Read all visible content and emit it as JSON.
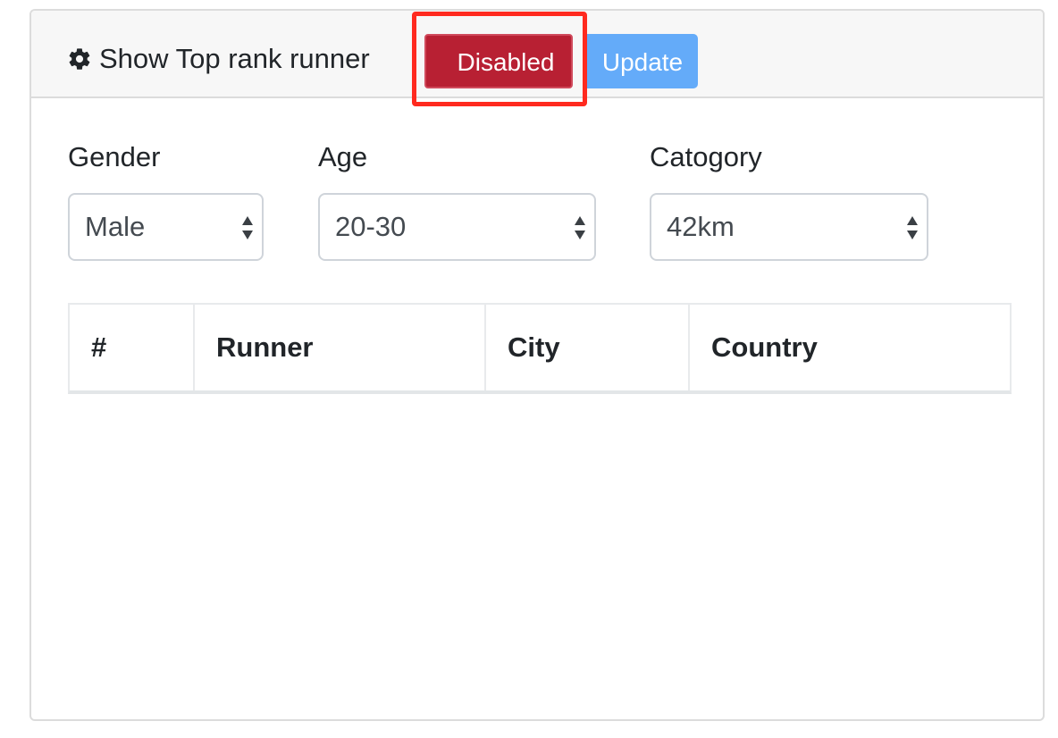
{
  "header": {
    "icon": "gear-icon",
    "title": "Show Top rank runner",
    "disabled_label": "Disabled",
    "update_label": "Update",
    "colors": {
      "disabled_bg": "#b82033",
      "update_bg": "#64abf9",
      "highlight": "#ff2a1f"
    }
  },
  "filters": {
    "gender": {
      "label": "Gender",
      "value": "Male"
    },
    "age": {
      "label": "Age",
      "value": "20-30"
    },
    "category": {
      "label": "Catogory",
      "value": "42km"
    }
  },
  "table": {
    "columns": [
      "#",
      "Runner",
      "City",
      "Country"
    ],
    "rows": []
  }
}
